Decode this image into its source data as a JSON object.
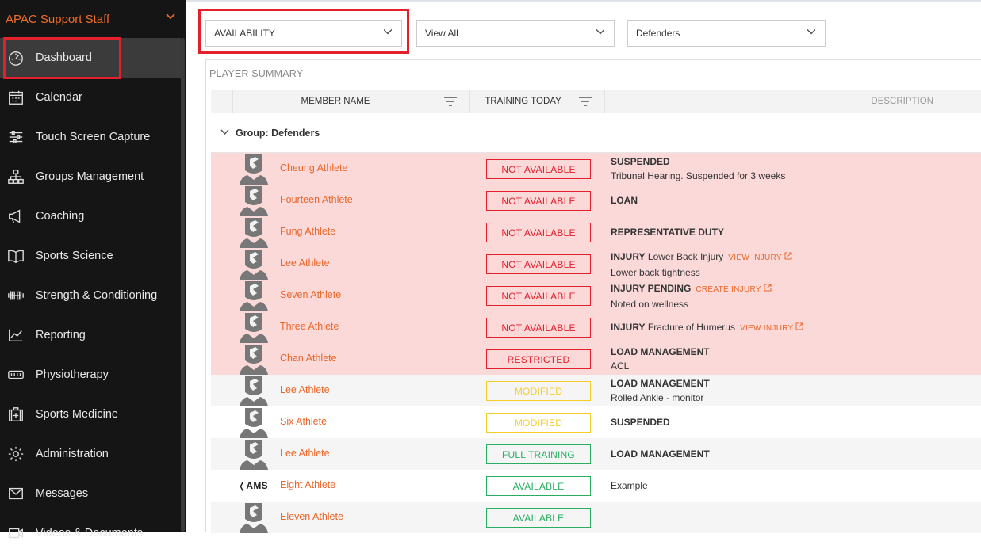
{
  "sidebar": {
    "org": "APAC Support Staff",
    "items": [
      {
        "label": "Dashboard",
        "icon": "dashboard-icon"
      },
      {
        "label": "Calendar",
        "icon": "calendar-icon"
      },
      {
        "label": "Touch Screen Capture",
        "icon": "sliders-icon"
      },
      {
        "label": "Groups Management",
        "icon": "hierarchy-icon"
      },
      {
        "label": "Coaching",
        "icon": "megaphone-icon"
      },
      {
        "label": "Sports Science",
        "icon": "book-icon"
      },
      {
        "label": "Strength & Conditioning",
        "icon": "dumbbell-icon"
      },
      {
        "label": "Reporting",
        "icon": "chart-icon"
      },
      {
        "label": "Physiotherapy",
        "icon": "physio-icon"
      },
      {
        "label": "Sports Medicine",
        "icon": "medkit-icon"
      },
      {
        "label": "Administration",
        "icon": "gear-icon"
      },
      {
        "label": "Messages",
        "icon": "mail-icon"
      },
      {
        "label": "Videos & Documents",
        "icon": "video-icon"
      }
    ]
  },
  "filters": {
    "category": "AVAILABILITY",
    "view": "View All",
    "group": "Defenders"
  },
  "panel": {
    "title": "PLAYER SUMMARY",
    "columns": {
      "member": "MEMBER NAME",
      "training": "TRAINING TODAY",
      "description": "DESCRIPTION"
    },
    "group_label": "Group: Defenders"
  },
  "rows": [
    {
      "name": "Cheung Athlete",
      "status": "NOT AVAILABLE",
      "kind": "na",
      "bg": "red",
      "title": "SUSPENDED",
      "sub": "Tribunal Hearing. Suspended for 3 weeks",
      "link": ""
    },
    {
      "name": "Fourteen Athlete",
      "status": "NOT AVAILABLE",
      "kind": "na",
      "bg": "red",
      "title": "LOAN",
      "sub": "",
      "link": ""
    },
    {
      "name": "Fung Athlete",
      "status": "NOT AVAILABLE",
      "kind": "na",
      "bg": "red",
      "title": "REPRESENTATIVE DUTY",
      "sub": "",
      "link": ""
    },
    {
      "name": "Lee Athlete",
      "status": "NOT AVAILABLE",
      "kind": "na",
      "bg": "red",
      "title": "INJURY",
      "inline": "Lower Back Injury",
      "sub": "Lower back tightness",
      "link": "VIEW INJURY"
    },
    {
      "name": "Seven Athlete",
      "status": "NOT AVAILABLE",
      "kind": "na",
      "bg": "red",
      "title": "INJURY PENDING",
      "sub": "Noted on wellness",
      "link": "CREATE INJURY"
    },
    {
      "name": "Three Athlete",
      "status": "NOT AVAILABLE",
      "kind": "na",
      "bg": "red",
      "title": "INJURY",
      "inline": "Fracture of Humerus",
      "sub": "",
      "link": "VIEW INJURY"
    },
    {
      "name": "Chan Athlete",
      "status": "RESTRICTED",
      "kind": "na",
      "bg": "red",
      "title": "LOAD MANAGEMENT",
      "sub": "ACL",
      "link": ""
    },
    {
      "name": "Lee Athlete",
      "status": "MODIFIED",
      "kind": "mod",
      "bg": "grey",
      "title": "LOAD MANAGEMENT",
      "sub": "Rolled Ankle - monitor",
      "link": ""
    },
    {
      "name": "Six Athlete",
      "status": "MODIFIED",
      "kind": "mod",
      "bg": "white",
      "title": "SUSPENDED",
      "sub": "",
      "link": ""
    },
    {
      "name": "Lee Athlete",
      "status": "FULL TRAINING",
      "kind": "ok",
      "bg": "grey",
      "title": "LOAD MANAGEMENT",
      "sub": "",
      "link": ""
    },
    {
      "name": "Eight Athlete",
      "status": "AVAILABLE",
      "kind": "ok",
      "bg": "white",
      "title": "",
      "plain": "Example",
      "sub": "",
      "link": "",
      "logo": "AMS"
    },
    {
      "name": "Eleven Athlete",
      "status": "AVAILABLE",
      "kind": "ok",
      "bg": "grey",
      "title": "",
      "sub": "",
      "link": ""
    }
  ],
  "colors": {
    "accent": "#e9672a",
    "red": "#e3202b",
    "yellow": "#f5cd2a",
    "green": "#27ae60",
    "sidebar": "#151515"
  }
}
